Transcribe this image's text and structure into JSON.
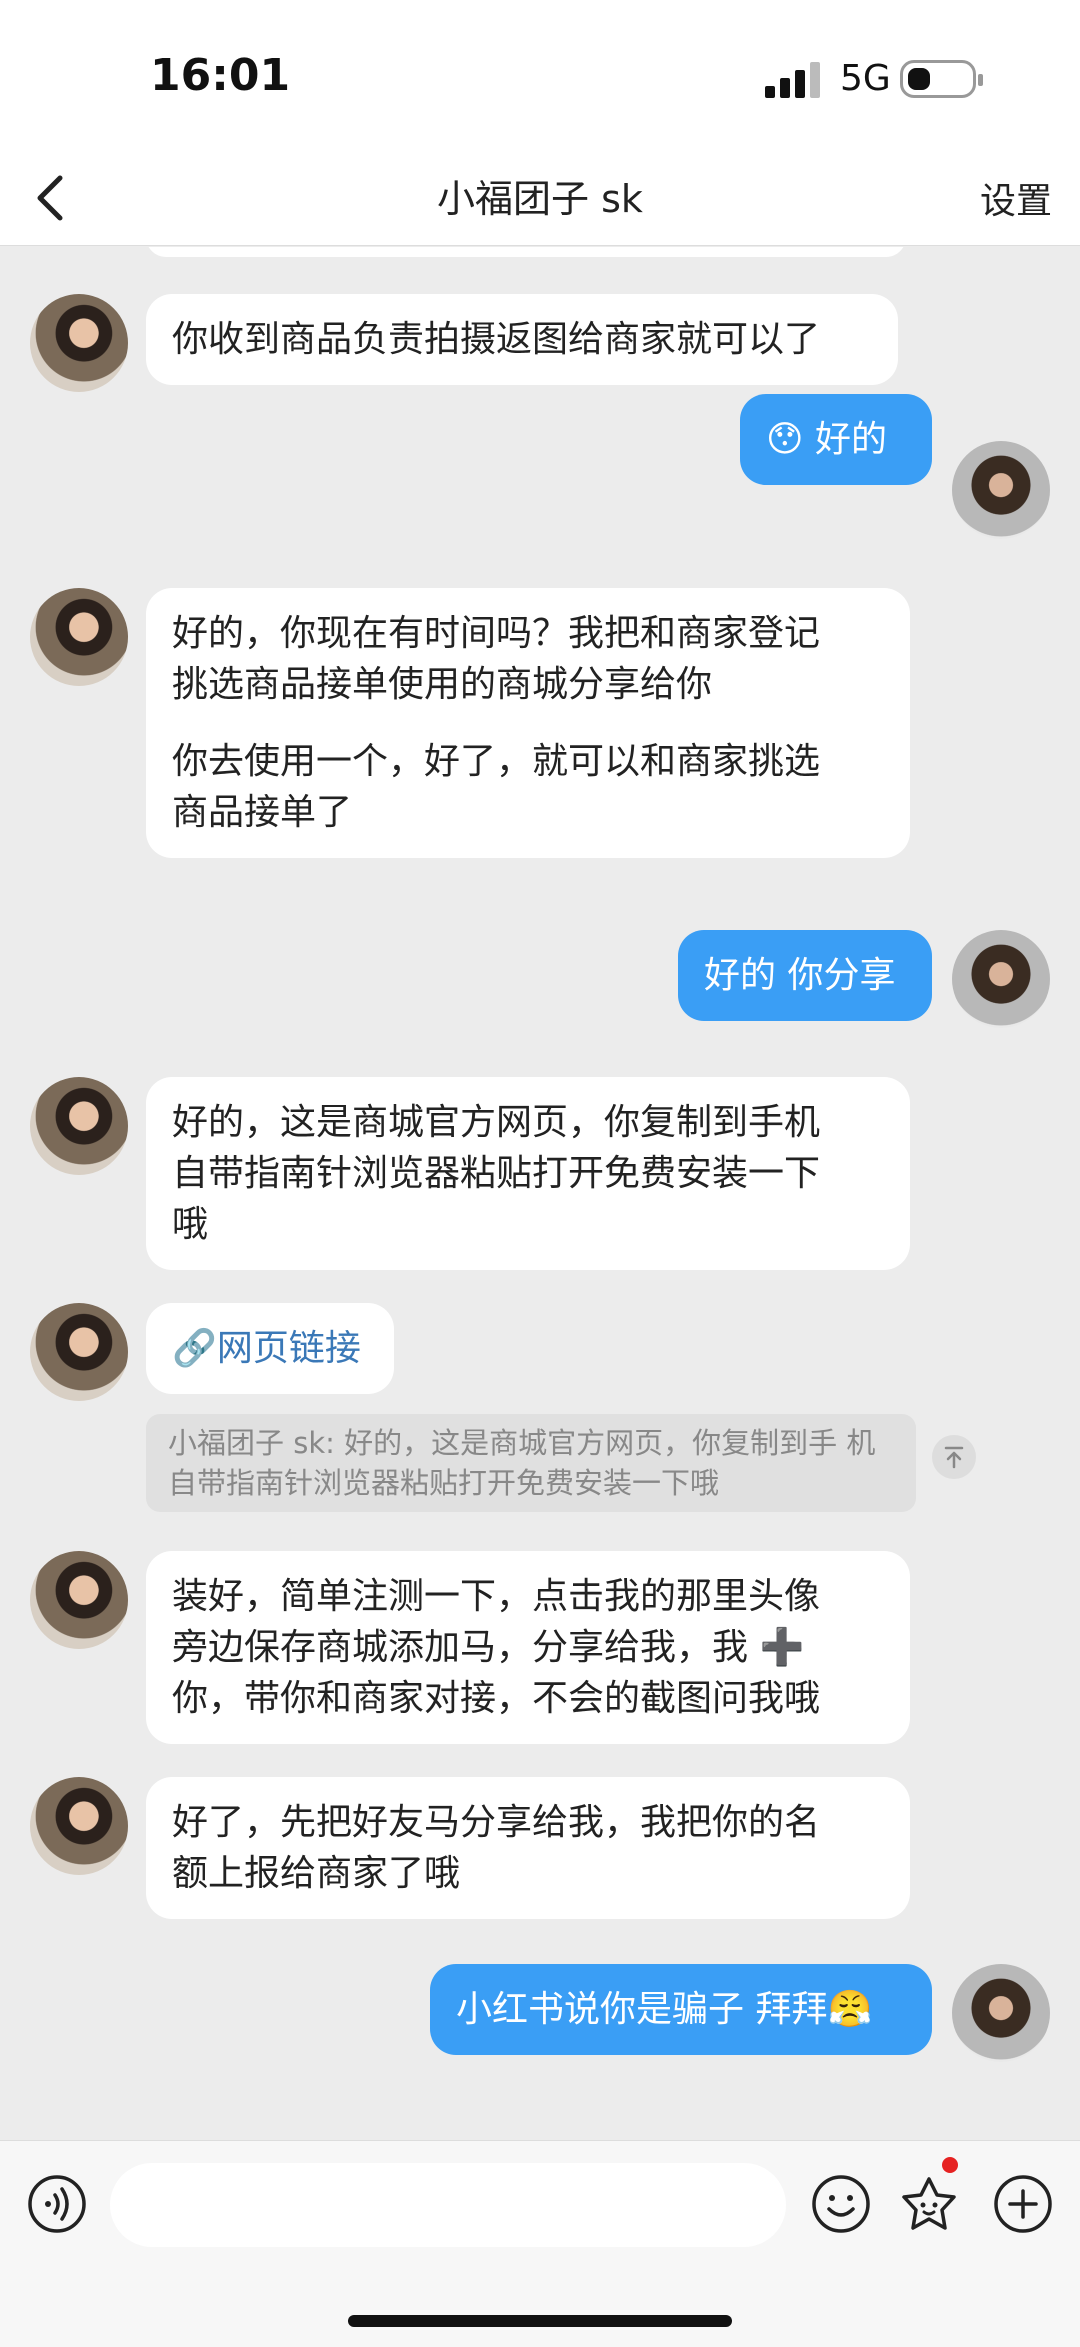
{
  "status": {
    "time": "16:01",
    "network": "5G"
  },
  "header": {
    "title": "小福团子 sk",
    "settings": "设置"
  },
  "messages": {
    "m1": "你收到商品负责拍摄返图给商家就可以了",
    "m2": "😯 好的",
    "m3_l1": "好的，你现在有时间吗？我把和商家登记",
    "m3_l2": "挑选商品接单使用的商城分享给你",
    "m3_l3": "你去使用一个，好了，就可以和商家挑选",
    "m3_l4": "商品接单了",
    "m4": "好的 你分享",
    "m5_l1": "好的，这是商城官方网页，你复制到手机",
    "m5_l2": "自带指南针浏览器粘贴打开免费安装一下",
    "m5_l3": "哦",
    "m6": "🔗网页链接",
    "quote_l1": "小福团子 sk: 好的，这是商城官方网页，你复制到手",
    "quote_l2": "机自带指南针浏览器粘贴打开免费安装一下哦",
    "m7_l1": "装好，简单注测一下，点击我的那里头像",
    "m7_l2": "旁边保存商城添加马，分享给我，我 ➕",
    "m7_l3": "你，带你和商家对接，不会的截图问我哦",
    "m8_l1": "好了，先把好友马分享给我，我把你的名",
    "m8_l2": "额上报给商家了哦",
    "m9": "小红书说你是骗子 拜拜😤"
  },
  "icons": {
    "back": "chevron-left-icon",
    "voice": "voice-icon",
    "emoji": "smiley-icon",
    "sticker": "sticker-icon",
    "add": "plus-circle-icon"
  },
  "colors": {
    "outgoing_bubble": "#3a9ef5",
    "incoming_bubble": "#ffffff",
    "link": "#3a78b7",
    "badge": "#e62222"
  }
}
